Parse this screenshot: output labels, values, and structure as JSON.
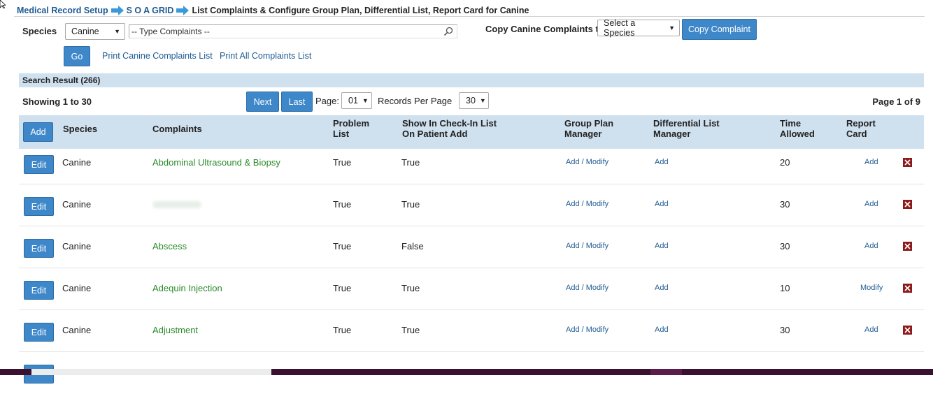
{
  "breadcrumb": {
    "root": "Medical Record Setup",
    "section": "S O A GRID",
    "current": "List Complaints & Configure Group Plan, Differential List, Report Card for Canine"
  },
  "filters": {
    "species_label": "Species",
    "species_value": "Canine",
    "complaints_value": "-- Type Complaints --",
    "copy_label": "Copy Canine Complaints to",
    "copy_select_value": "Select a Species",
    "copy_button": "Copy Complaint",
    "go_button": "Go",
    "print_species_link": "Print Canine Complaints List",
    "print_all_link": "Print All Complaints List"
  },
  "results": {
    "header": "Search Result (266)",
    "showing": "Showing 1 to 30",
    "next_button": "Next",
    "last_button": "Last",
    "page_label": "Page:",
    "page_value": "01",
    "per_page_label": "Records Per Page",
    "per_page_value": "30",
    "page_of": "Page 1 of 9"
  },
  "table": {
    "add_button": "Add",
    "columns": {
      "species": "Species",
      "complaints": "Complaints",
      "problem_list_1": "Problem",
      "problem_list_2": "List",
      "checkin_1": "Show In Check-In List",
      "checkin_2": "On Patient Add",
      "group_plan_1": "Group Plan",
      "group_plan_2": "Manager",
      "diff_1": "Differential List",
      "diff_2": "Manager",
      "time_1": "Time",
      "time_2": "Allowed",
      "report_1": "Report",
      "report_2": "Card"
    },
    "rows": [
      {
        "edit": "Edit",
        "species": "Canine",
        "complaint": "Abdominal Ultrasound & Biopsy",
        "problem_list": "True",
        "checkin": "True",
        "group_plan": "Add / Modify",
        "differential": "Add",
        "time": "20",
        "report_card": "Add"
      },
      {
        "edit": "Edit",
        "species": "Canine",
        "complaint": "",
        "problem_list": "True",
        "checkin": "True",
        "group_plan": "Add / Modify",
        "differential": "Add",
        "time": "30",
        "report_card": "Add"
      },
      {
        "edit": "Edit",
        "species": "Canine",
        "complaint": "Abscess",
        "problem_list": "True",
        "checkin": "False",
        "group_plan": "Add / Modify",
        "differential": "Add",
        "time": "30",
        "report_card": "Add"
      },
      {
        "edit": "Edit",
        "species": "Canine",
        "complaint": "Adequin Injection",
        "problem_list": "True",
        "checkin": "True",
        "group_plan": "Add / Modify",
        "differential": "Add",
        "time": "10",
        "report_card": "Modify"
      },
      {
        "edit": "Edit",
        "species": "Canine",
        "complaint": "Adjustment",
        "problem_list": "True",
        "checkin": "True",
        "group_plan": "Add / Modify",
        "differential": "Add",
        "time": "30",
        "report_card": "Add"
      }
    ]
  },
  "icons": {
    "breadcrumb_arrow": "arrow-right-icon",
    "search": "magnifier-icon",
    "delete": "delete-x-icon"
  },
  "colors": {
    "link": "#1f5b93",
    "button": "#3e87c9",
    "header_bg": "#cfe0ee",
    "complaint_text": "#2a8a2a",
    "delete": "#8e1b1b"
  }
}
